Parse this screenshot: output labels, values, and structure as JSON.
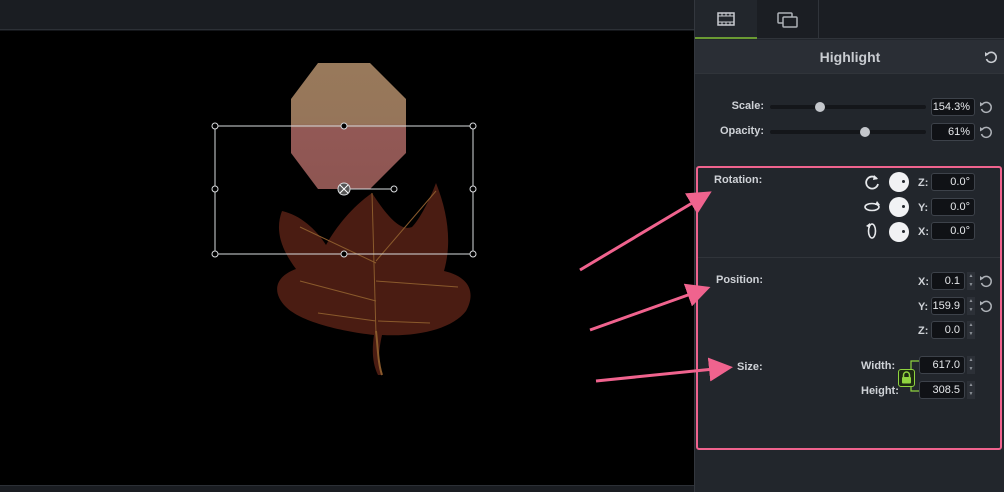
{
  "panel": {
    "tabs": [
      {
        "id": "visual-properties",
        "icon": "film-strip-icon",
        "active": true
      },
      {
        "id": "captions",
        "icon": "captions-icon",
        "active": false
      }
    ],
    "title": "Highlight"
  },
  "properties": {
    "scale": {
      "label": "Scale:",
      "value": "154.3%",
      "slider_fraction": 0.32
    },
    "opacity": {
      "label": "Opacity:",
      "value": "61%",
      "slider_fraction": 0.61
    }
  },
  "rotation": {
    "label": "Rotation:",
    "axes": [
      {
        "axis": "Z:",
        "value": "0.0°",
        "icon": "rotate-z-icon"
      },
      {
        "axis": "Y:",
        "value": "0.0°",
        "icon": "rotate-y-icon"
      },
      {
        "axis": "X:",
        "value": "0.0°",
        "icon": "rotate-x-icon"
      }
    ]
  },
  "position": {
    "label": "Position:",
    "x": {
      "label": "X:",
      "value": "0.1"
    },
    "y": {
      "label": "Y:",
      "value": "159.9"
    },
    "z": {
      "label": "Z:",
      "value": "0.0"
    }
  },
  "size": {
    "label": "Size:",
    "width": {
      "label": "Width:",
      "value": "617.0"
    },
    "height": {
      "label": "Height:",
      "value": "308.5"
    },
    "aspect_locked": true
  },
  "colors": {
    "annotation_pink": "#f0638e",
    "accent_green": "#8fd43f",
    "panel_bg": "#22262c",
    "canvas_bg": "#000000"
  }
}
